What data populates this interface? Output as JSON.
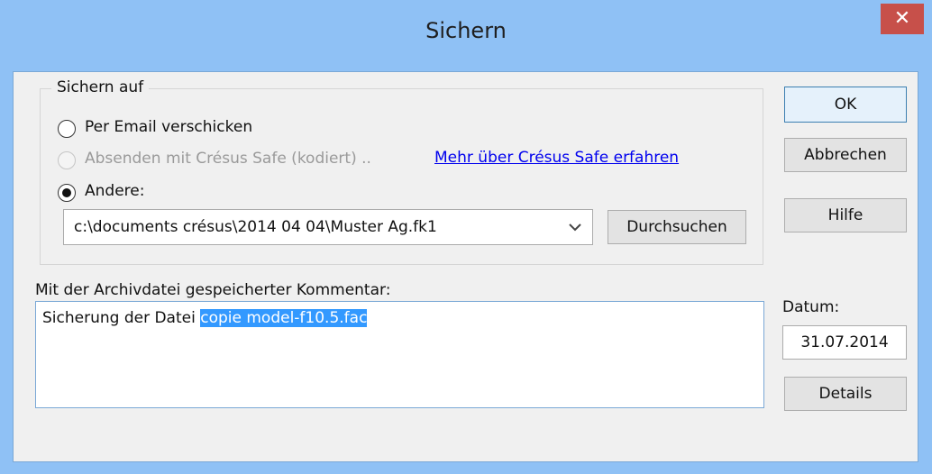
{
  "window": {
    "title": "Sichern",
    "close_glyph": "✕"
  },
  "group": {
    "label": "Sichern auf",
    "options": [
      {
        "label": "Per Email verschicken",
        "selected": false,
        "enabled": true
      },
      {
        "label": "Absenden mit Crésus Safe (kodiert) ..",
        "selected": false,
        "enabled": false
      },
      {
        "label": "Andere:",
        "selected": true,
        "enabled": true
      }
    ],
    "link_text": "Mehr über Crésus Safe erfahren",
    "path_value": "c:\\documents crésus\\2014 04 04\\Muster Ag.fk1",
    "browse_label": "Durchsuchen"
  },
  "buttons": {
    "ok": "OK",
    "cancel": "Abbrechen",
    "help": "Hilfe",
    "details": "Details"
  },
  "comment": {
    "label": "Mit der Archivdatei gespeicherter Kommentar:",
    "text_plain": "Sicherung der Datei ",
    "text_selected": "copie model-f10.5.fac"
  },
  "date": {
    "label": "Datum:",
    "value": "31.07.2014"
  },
  "colors": {
    "titlebar": "#8fc1f5",
    "close": "#c7504a",
    "selection": "#3399ff",
    "link": "#0000ee"
  }
}
